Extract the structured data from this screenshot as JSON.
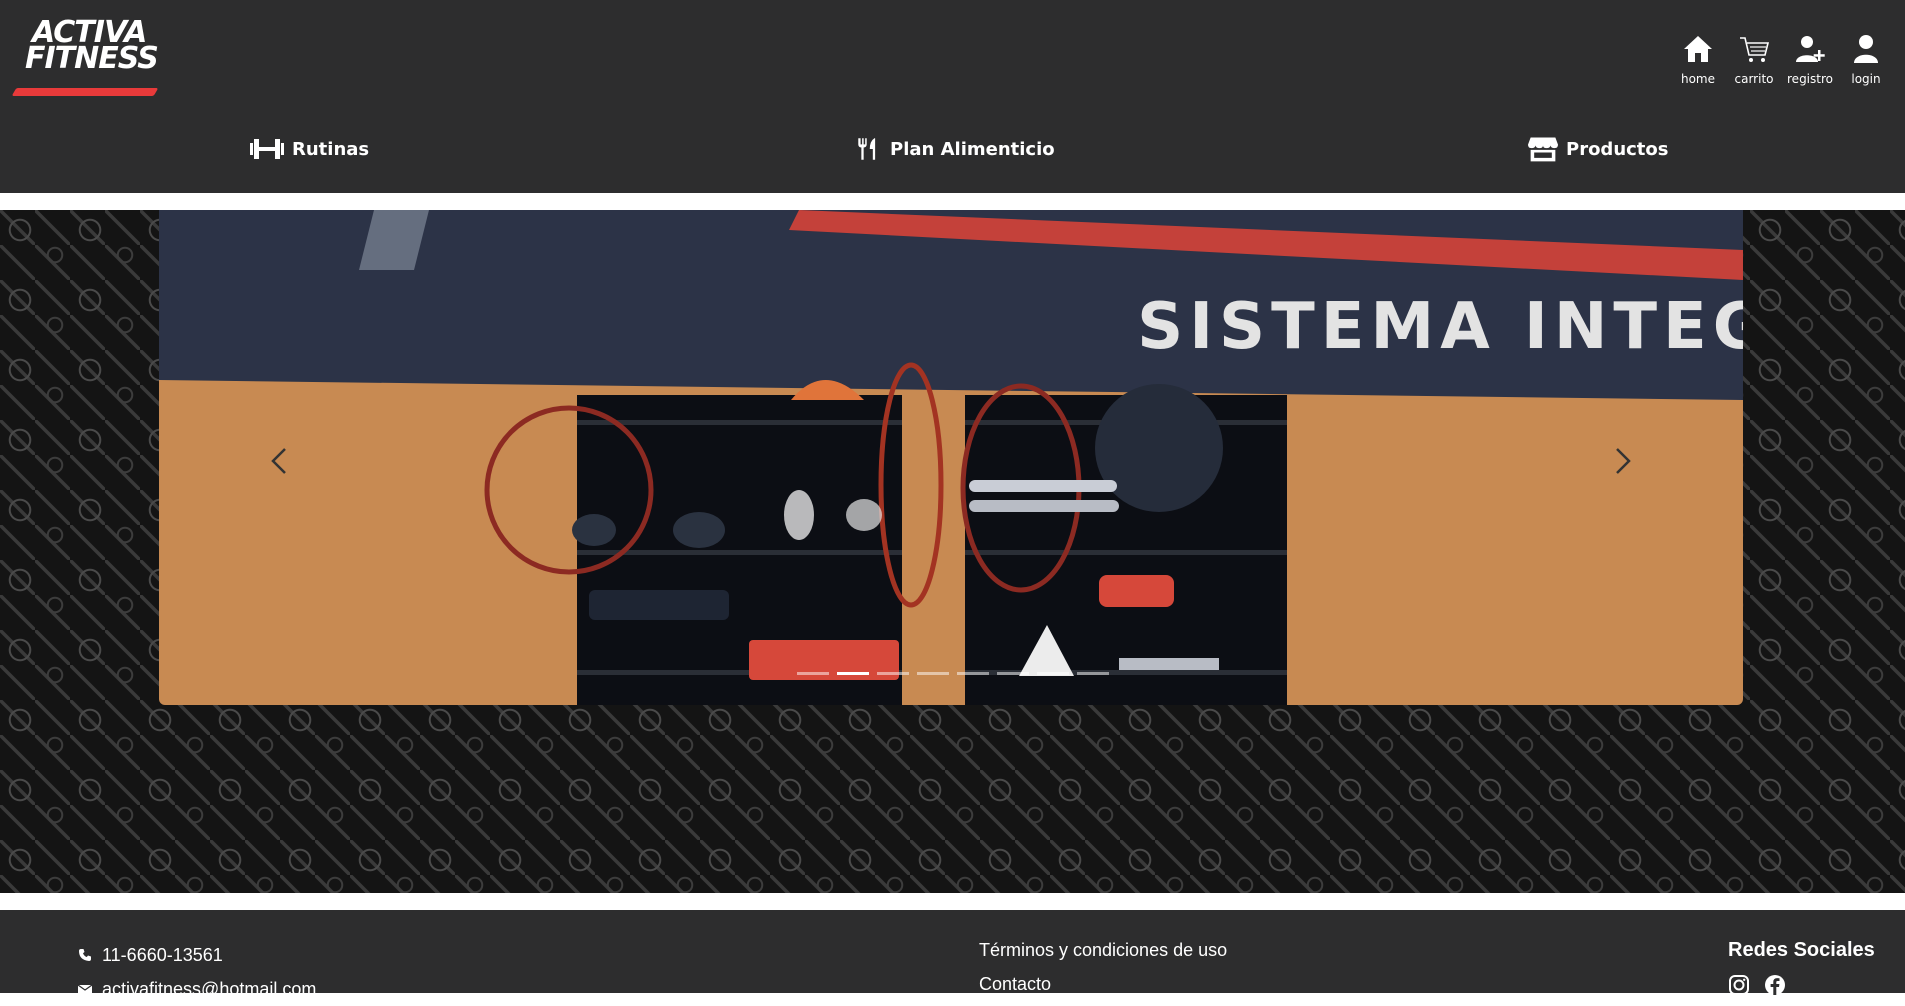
{
  "brand": {
    "line1": "ACTIVA",
    "line2": "FITNESS",
    "accent_color": "#e83a3a"
  },
  "user_nav": [
    {
      "label": "home",
      "icon": "home-icon"
    },
    {
      "label": "carrito",
      "icon": "cart-icon"
    },
    {
      "label": "registro",
      "icon": "user-plus-icon"
    },
    {
      "label": "login",
      "icon": "user-icon"
    }
  ],
  "main_nav": [
    {
      "label": "Rutinas",
      "icon": "dumbbell-icon"
    },
    {
      "label": "Plan Alimenticio",
      "icon": "utensils-icon"
    },
    {
      "label": "Productos",
      "icon": "store-icon"
    }
  ],
  "carousel": {
    "slide_text": "SISTEMA INTEGRAL",
    "slide_count": 8,
    "active_index": 1
  },
  "footer": {
    "phone": "11-6660-13561",
    "email": "activafitness@hotmail.com",
    "links": [
      "Términos y condiciones de uso",
      "Contacto"
    ],
    "social_title": "Redes Sociales",
    "social_icons": [
      "instagram-icon",
      "facebook-icon"
    ]
  },
  "colors": {
    "header_bg": "#2d2d2e",
    "footer_bg": "#2d2d2e",
    "pattern_bg": "#141414"
  }
}
